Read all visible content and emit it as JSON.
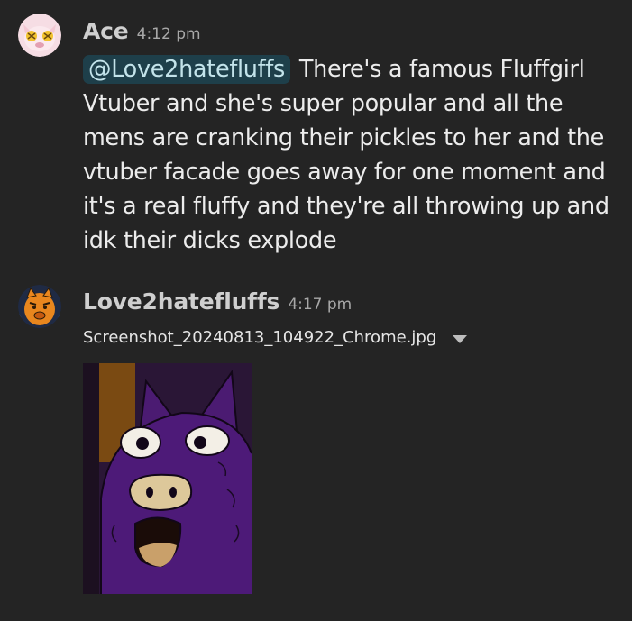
{
  "messages": [
    {
      "author": "Ace",
      "time": "4:12 pm",
      "mention": "@Love2hatefluffs",
      "text_lines": [
        "There's a famous Fluffgirl",
        "Vtuber and she's super popular and all the",
        "mens are cranking their pickles to her and the",
        "vtuber facade goes away for one moment and",
        "it's a real fluffy and they're all throwing up and",
        "idk their dicks explode"
      ],
      "avatar_icon": "pink-creature-avatar-icon"
    },
    {
      "author": "Love2hatefluffs",
      "time": "4:17 pm",
      "attachment": {
        "filename": "Screenshot_20240813_104922_Chrome.jpg",
        "menu_icon": "chevron-down-icon"
      },
      "avatar_icon": "orange-creature-avatar-icon"
    }
  ],
  "colors": {
    "background": "#242424",
    "mention_bg": "#1e3f4a",
    "mention_text": "#c3e3ea"
  }
}
